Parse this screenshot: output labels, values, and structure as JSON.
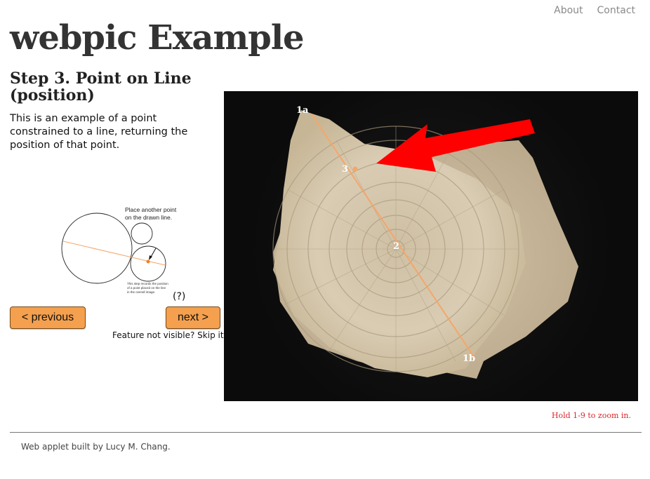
{
  "nav": {
    "about": "About",
    "contact": "Contact"
  },
  "site": {
    "title": "webpic Example"
  },
  "step": {
    "title": "Step 3. Point on Line (position)",
    "description": "This is an example of a point constrained to a line, returning the position of that point."
  },
  "diagram": {
    "instruction_line1": "Place another point",
    "instruction_line2": "on the drawn line.",
    "note_line1": "This step records the position",
    "note_line2": "of a point placed on the line",
    "note_line3": "in the overall image.",
    "help": "(?)"
  },
  "buttons": {
    "previous": "< previous",
    "next": "next >"
  },
  "skip": {
    "prefix": "Feature not visible? ",
    "link": "Skip it >"
  },
  "photo": {
    "labels": {
      "p1a": "1a",
      "p1b": "1b",
      "p2": "2",
      "p3": "3"
    },
    "line_color": "#f5a66a",
    "arrow_color": "#ff0000"
  },
  "zoom_hint": "Hold 1-9 to zoom in.",
  "footer": "Web applet built by Lucy M. Chang."
}
